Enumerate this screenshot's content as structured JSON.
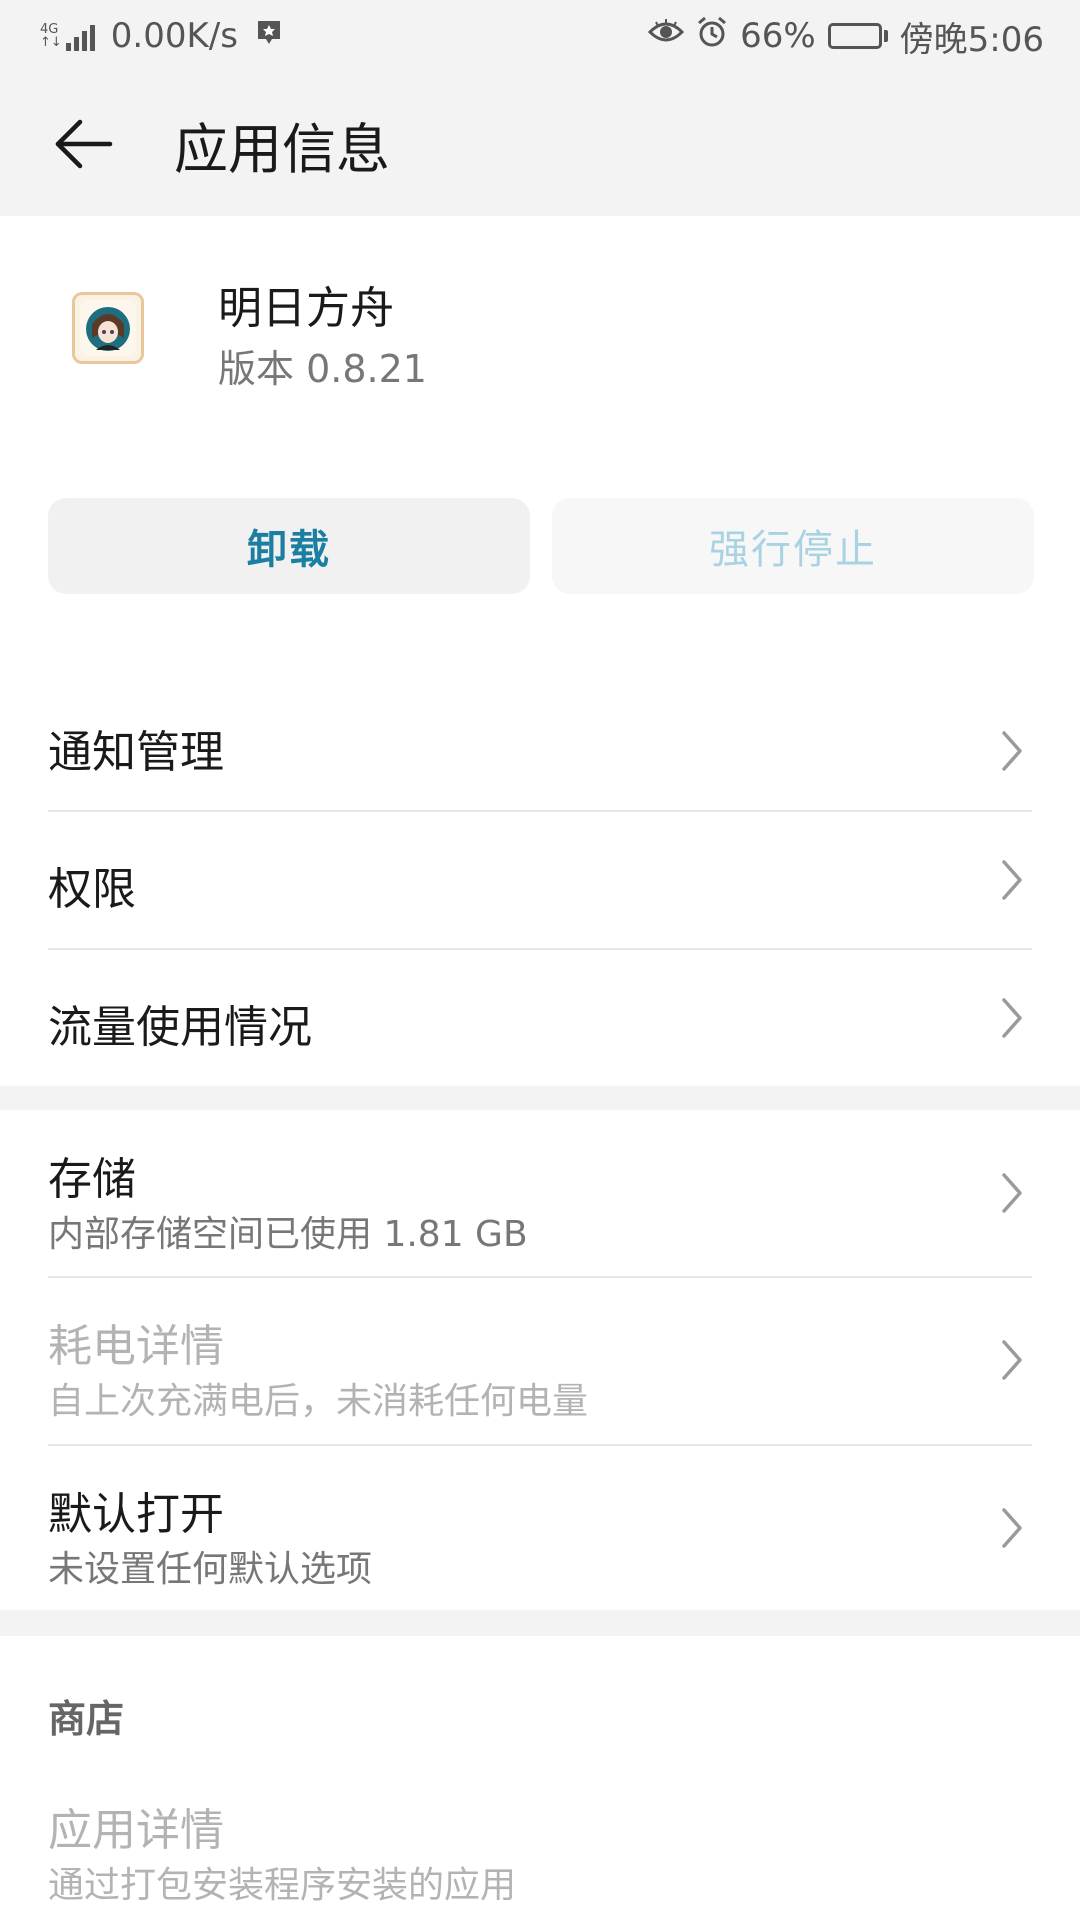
{
  "status_bar": {
    "network_type": "4G",
    "network_sub": "↑↓",
    "speed": "0.00K/s",
    "battery_percent": "66%",
    "battery_level": 0.66,
    "time": "傍晚5:06"
  },
  "header": {
    "title": "应用信息"
  },
  "app": {
    "name": "明日方舟",
    "version": "版本 0.8.21"
  },
  "buttons": {
    "uninstall": "卸载",
    "force_stop": "强行停止"
  },
  "items": [
    {
      "title": "通知管理"
    },
    {
      "title": "权限"
    },
    {
      "title": "流量使用情况"
    }
  ],
  "storage_items": [
    {
      "title": "存储",
      "subtitle": "内部存储空间已使用 1.81 GB"
    },
    {
      "title": "耗电详情",
      "subtitle": "自上次充满电后，未消耗任何电量"
    },
    {
      "title": "默认打开",
      "subtitle": "未设置任何默认选项"
    }
  ],
  "store": {
    "header": "商店",
    "item_title": "应用详情",
    "item_subtitle": "通过打包安装程序安装的应用"
  },
  "colors": {
    "accent": "#1a7fa0",
    "accent_disabled": "#a9d3e2",
    "background": "#f3f3f3"
  }
}
